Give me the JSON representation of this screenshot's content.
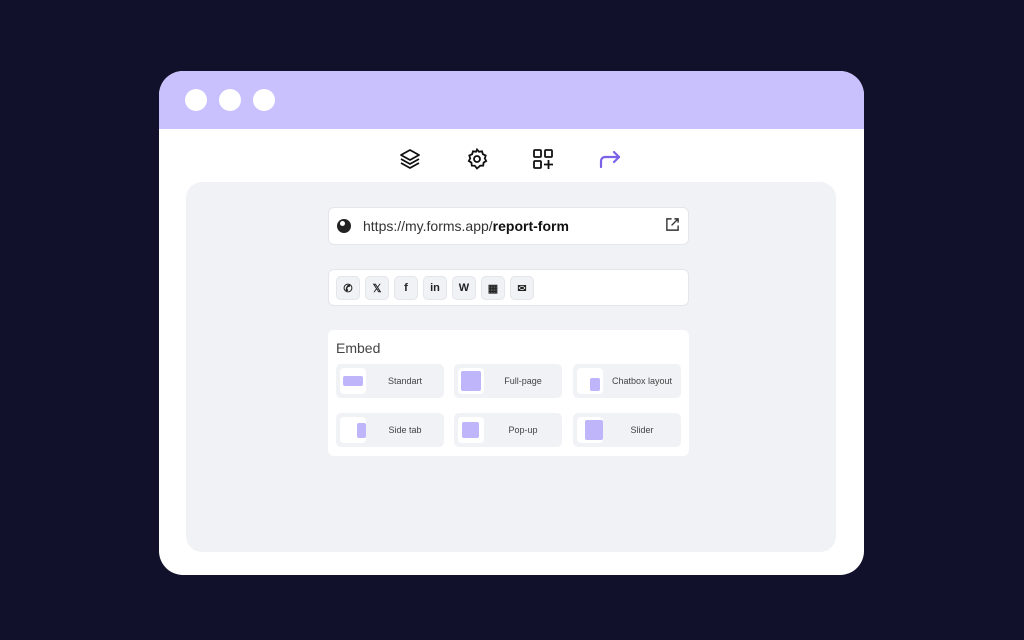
{
  "window": {
    "controls": [
      "close",
      "minimize",
      "maximize"
    ]
  },
  "toolbar": [
    {
      "icon": "layers-icon"
    },
    {
      "icon": "gear-icon"
    },
    {
      "icon": "add-widget-icon"
    },
    {
      "icon": "share-arrow-icon",
      "active": true,
      "color": "#7b61e8"
    }
  ],
  "url": {
    "prefix": "https://my.forms.app/",
    "slug": "report-form"
  },
  "share": [
    {
      "icon": "whatsapp-icon",
      "glyph": "✆"
    },
    {
      "icon": "x-icon",
      "glyph": "𝕏"
    },
    {
      "icon": "facebook-icon",
      "glyph": "f"
    },
    {
      "icon": "linkedin-icon",
      "glyph": "in"
    },
    {
      "icon": "wordpress-icon",
      "glyph": "W"
    },
    {
      "icon": "qr-code-icon",
      "glyph": "▦"
    },
    {
      "icon": "email-icon",
      "glyph": "✉"
    }
  ],
  "embed": {
    "title": "Embed",
    "options": [
      "Standart",
      "Full-page",
      "Chatbox layout",
      "Side tab",
      "Pop-up",
      "Slider"
    ]
  }
}
